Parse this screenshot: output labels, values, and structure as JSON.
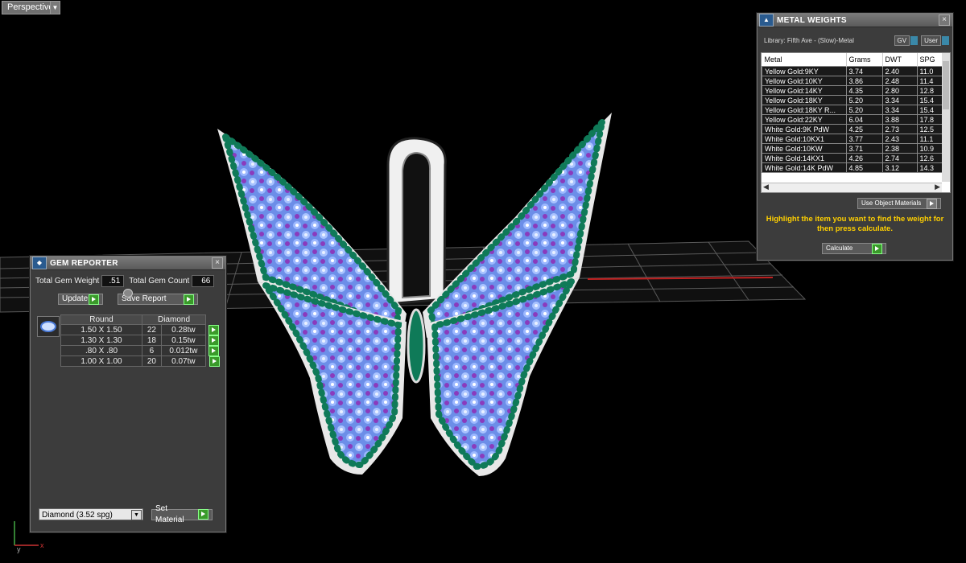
{
  "viewport": {
    "mode": "Perspective",
    "axis_labels": {
      "x": "x",
      "y": "y"
    }
  },
  "gem_reporter": {
    "title": "GEM REPORTER",
    "total_weight_label": "Total Gem Weight",
    "total_weight_value": ".51",
    "total_count_label": "Total Gem Count",
    "total_count_value": "66",
    "update_label": "Update",
    "save_report_label": "Save Report",
    "table_headers": [
      "Round",
      "Diamond"
    ],
    "rows": [
      {
        "size": "1.50 X 1.50",
        "count": "22",
        "weight": "0.28tw"
      },
      {
        "size": "1.30 X 1.30",
        "count": "18",
        "weight": "0.15tw"
      },
      {
        "size": ".80 X .80",
        "count": "6",
        "weight": "0.012tw"
      },
      {
        "size": "1.00 X 1.00",
        "count": "20",
        "weight": "0.07tw"
      }
    ],
    "material_select": "Diamond     (3.52 spg)",
    "set_material_label": "Set Material"
  },
  "metal_weights": {
    "title": "METAL WEIGHTS",
    "library": "Library: Fifth Ave - (Slow)-Metal",
    "toggle_gv": "GV",
    "toggle_user": "User",
    "columns": [
      "Metal",
      "Grams",
      "DWT",
      "SPG"
    ],
    "rows": [
      [
        "Yellow Gold:9KY",
        "3.74",
        "2.40",
        "11.0"
      ],
      [
        "Yellow Gold:10KY",
        "3.86",
        "2.48",
        "11.4"
      ],
      [
        "Yellow Gold:14KY",
        "4.35",
        "2.80",
        "12.8"
      ],
      [
        "Yellow Gold:18KY",
        "5.20",
        "3.34",
        "15.4"
      ],
      [
        "Yellow Gold:18KY R...",
        "5.20",
        "3.34",
        "15.4"
      ],
      [
        "Yellow Gold:22KY",
        "6.04",
        "3.88",
        "17.8"
      ],
      [
        "White Gold:9K PdW",
        "4.25",
        "2.73",
        "12.5"
      ],
      [
        "White Gold:10KX1",
        "3.77",
        "2.43",
        "11.1"
      ],
      [
        "White Gold:10KW",
        "3.71",
        "2.38",
        "10.9"
      ],
      [
        "White Gold:14KX1",
        "4.26",
        "2.74",
        "12.6"
      ],
      [
        "White Gold:14K PdW",
        "4.85",
        "3.12",
        "14.3"
      ]
    ],
    "use_object_label": "Use Object Materials",
    "hint": "Highlight the item you want to find the weight for then press calculate.",
    "calculate_label": "Calculate"
  },
  "colors": {
    "emerald": "#0f7a58",
    "sapphire": "#7aa4ff",
    "amethyst": "#7a2fa8",
    "metal": "#e6e6e6"
  }
}
